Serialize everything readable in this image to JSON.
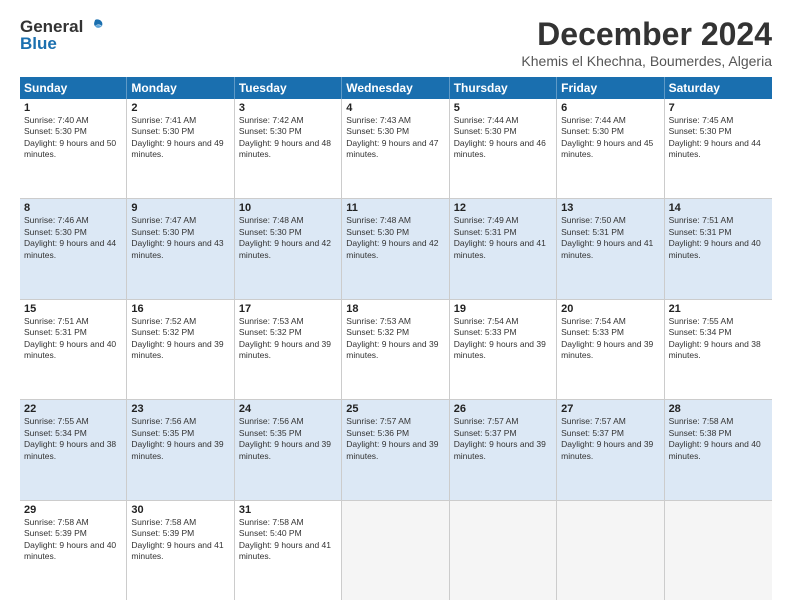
{
  "logo": {
    "general": "General",
    "blue": "Blue"
  },
  "title": "December 2024",
  "location": "Khemis el Khechna, Boumerdes, Algeria",
  "days": [
    "Sunday",
    "Monday",
    "Tuesday",
    "Wednesday",
    "Thursday",
    "Friday",
    "Saturday"
  ],
  "weeks": [
    [
      {
        "day": "1",
        "sunrise": "Sunrise: 7:40 AM",
        "sunset": "Sunset: 5:30 PM",
        "daylight": "Daylight: 9 hours and 50 minutes."
      },
      {
        "day": "2",
        "sunrise": "Sunrise: 7:41 AM",
        "sunset": "Sunset: 5:30 PM",
        "daylight": "Daylight: 9 hours and 49 minutes."
      },
      {
        "day": "3",
        "sunrise": "Sunrise: 7:42 AM",
        "sunset": "Sunset: 5:30 PM",
        "daylight": "Daylight: 9 hours and 48 minutes."
      },
      {
        "day": "4",
        "sunrise": "Sunrise: 7:43 AM",
        "sunset": "Sunset: 5:30 PM",
        "daylight": "Daylight: 9 hours and 47 minutes."
      },
      {
        "day": "5",
        "sunrise": "Sunrise: 7:44 AM",
        "sunset": "Sunset: 5:30 PM",
        "daylight": "Daylight: 9 hours and 46 minutes."
      },
      {
        "day": "6",
        "sunrise": "Sunrise: 7:44 AM",
        "sunset": "Sunset: 5:30 PM",
        "daylight": "Daylight: 9 hours and 45 minutes."
      },
      {
        "day": "7",
        "sunrise": "Sunrise: 7:45 AM",
        "sunset": "Sunset: 5:30 PM",
        "daylight": "Daylight: 9 hours and 44 minutes."
      }
    ],
    [
      {
        "day": "8",
        "sunrise": "Sunrise: 7:46 AM",
        "sunset": "Sunset: 5:30 PM",
        "daylight": "Daylight: 9 hours and 44 minutes."
      },
      {
        "day": "9",
        "sunrise": "Sunrise: 7:47 AM",
        "sunset": "Sunset: 5:30 PM",
        "daylight": "Daylight: 9 hours and 43 minutes."
      },
      {
        "day": "10",
        "sunrise": "Sunrise: 7:48 AM",
        "sunset": "Sunset: 5:30 PM",
        "daylight": "Daylight: 9 hours and 42 minutes."
      },
      {
        "day": "11",
        "sunrise": "Sunrise: 7:48 AM",
        "sunset": "Sunset: 5:30 PM",
        "daylight": "Daylight: 9 hours and 42 minutes."
      },
      {
        "day": "12",
        "sunrise": "Sunrise: 7:49 AM",
        "sunset": "Sunset: 5:31 PM",
        "daylight": "Daylight: 9 hours and 41 minutes."
      },
      {
        "day": "13",
        "sunrise": "Sunrise: 7:50 AM",
        "sunset": "Sunset: 5:31 PM",
        "daylight": "Daylight: 9 hours and 41 minutes."
      },
      {
        "day": "14",
        "sunrise": "Sunrise: 7:51 AM",
        "sunset": "Sunset: 5:31 PM",
        "daylight": "Daylight: 9 hours and 40 minutes."
      }
    ],
    [
      {
        "day": "15",
        "sunrise": "Sunrise: 7:51 AM",
        "sunset": "Sunset: 5:31 PM",
        "daylight": "Daylight: 9 hours and 40 minutes."
      },
      {
        "day": "16",
        "sunrise": "Sunrise: 7:52 AM",
        "sunset": "Sunset: 5:32 PM",
        "daylight": "Daylight: 9 hours and 39 minutes."
      },
      {
        "day": "17",
        "sunrise": "Sunrise: 7:53 AM",
        "sunset": "Sunset: 5:32 PM",
        "daylight": "Daylight: 9 hours and 39 minutes."
      },
      {
        "day": "18",
        "sunrise": "Sunrise: 7:53 AM",
        "sunset": "Sunset: 5:32 PM",
        "daylight": "Daylight: 9 hours and 39 minutes."
      },
      {
        "day": "19",
        "sunrise": "Sunrise: 7:54 AM",
        "sunset": "Sunset: 5:33 PM",
        "daylight": "Daylight: 9 hours and 39 minutes."
      },
      {
        "day": "20",
        "sunrise": "Sunrise: 7:54 AM",
        "sunset": "Sunset: 5:33 PM",
        "daylight": "Daylight: 9 hours and 39 minutes."
      },
      {
        "day": "21",
        "sunrise": "Sunrise: 7:55 AM",
        "sunset": "Sunset: 5:34 PM",
        "daylight": "Daylight: 9 hours and 38 minutes."
      }
    ],
    [
      {
        "day": "22",
        "sunrise": "Sunrise: 7:55 AM",
        "sunset": "Sunset: 5:34 PM",
        "daylight": "Daylight: 9 hours and 38 minutes."
      },
      {
        "day": "23",
        "sunrise": "Sunrise: 7:56 AM",
        "sunset": "Sunset: 5:35 PM",
        "daylight": "Daylight: 9 hours and 39 minutes."
      },
      {
        "day": "24",
        "sunrise": "Sunrise: 7:56 AM",
        "sunset": "Sunset: 5:35 PM",
        "daylight": "Daylight: 9 hours and 39 minutes."
      },
      {
        "day": "25",
        "sunrise": "Sunrise: 7:57 AM",
        "sunset": "Sunset: 5:36 PM",
        "daylight": "Daylight: 9 hours and 39 minutes."
      },
      {
        "day": "26",
        "sunrise": "Sunrise: 7:57 AM",
        "sunset": "Sunset: 5:37 PM",
        "daylight": "Daylight: 9 hours and 39 minutes."
      },
      {
        "day": "27",
        "sunrise": "Sunrise: 7:57 AM",
        "sunset": "Sunset: 5:37 PM",
        "daylight": "Daylight: 9 hours and 39 minutes."
      },
      {
        "day": "28",
        "sunrise": "Sunrise: 7:58 AM",
        "sunset": "Sunset: 5:38 PM",
        "daylight": "Daylight: 9 hours and 40 minutes."
      }
    ],
    [
      {
        "day": "29",
        "sunrise": "Sunrise: 7:58 AM",
        "sunset": "Sunset: 5:39 PM",
        "daylight": "Daylight: 9 hours and 40 minutes."
      },
      {
        "day": "30",
        "sunrise": "Sunrise: 7:58 AM",
        "sunset": "Sunset: 5:39 PM",
        "daylight": "Daylight: 9 hours and 41 minutes."
      },
      {
        "day": "31",
        "sunrise": "Sunrise: 7:58 AM",
        "sunset": "Sunset: 5:40 PM",
        "daylight": "Daylight: 9 hours and 41 minutes."
      },
      null,
      null,
      null,
      null
    ]
  ]
}
